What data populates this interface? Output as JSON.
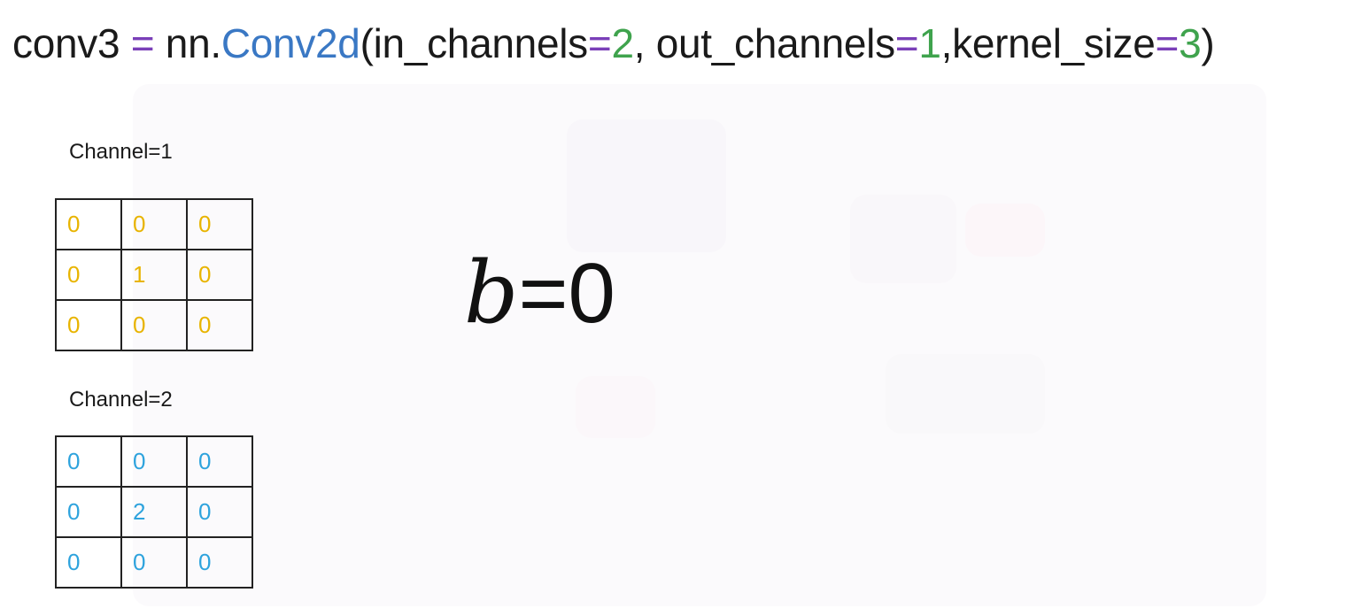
{
  "code": {
    "var": "conv3",
    "eq1": " = ",
    "module": "nn.",
    "cls": "Conv2d",
    "open": "(",
    "p1_name": "in_channels",
    "p1_eq": "=",
    "p1_val": "2",
    "sep1": ", ",
    "p2_name": "out_channels",
    "p2_eq": "=",
    "p2_val": "1",
    "sep2": ",",
    "p3_name": "kernel_size",
    "p3_eq": "=",
    "p3_val": "3",
    "close": ")"
  },
  "colors": {
    "keyword_eq": "#7a3fb8",
    "class_name": "#3a78c4",
    "number": "#3fa34d",
    "channel1": "#e8b400",
    "channel2": "#2ea3dd"
  },
  "channel1": {
    "label": "Channel=1",
    "rows": [
      [
        "0",
        "0",
        "0"
      ],
      [
        "0",
        "1",
        "0"
      ],
      [
        "0",
        "0",
        "0"
      ]
    ]
  },
  "channel2": {
    "label": "Channel=2",
    "rows": [
      [
        "0",
        "0",
        "0"
      ],
      [
        "0",
        "2",
        "0"
      ],
      [
        "0",
        "0",
        "0"
      ]
    ]
  },
  "bias": {
    "symbol": "b",
    "rest": "=0"
  }
}
